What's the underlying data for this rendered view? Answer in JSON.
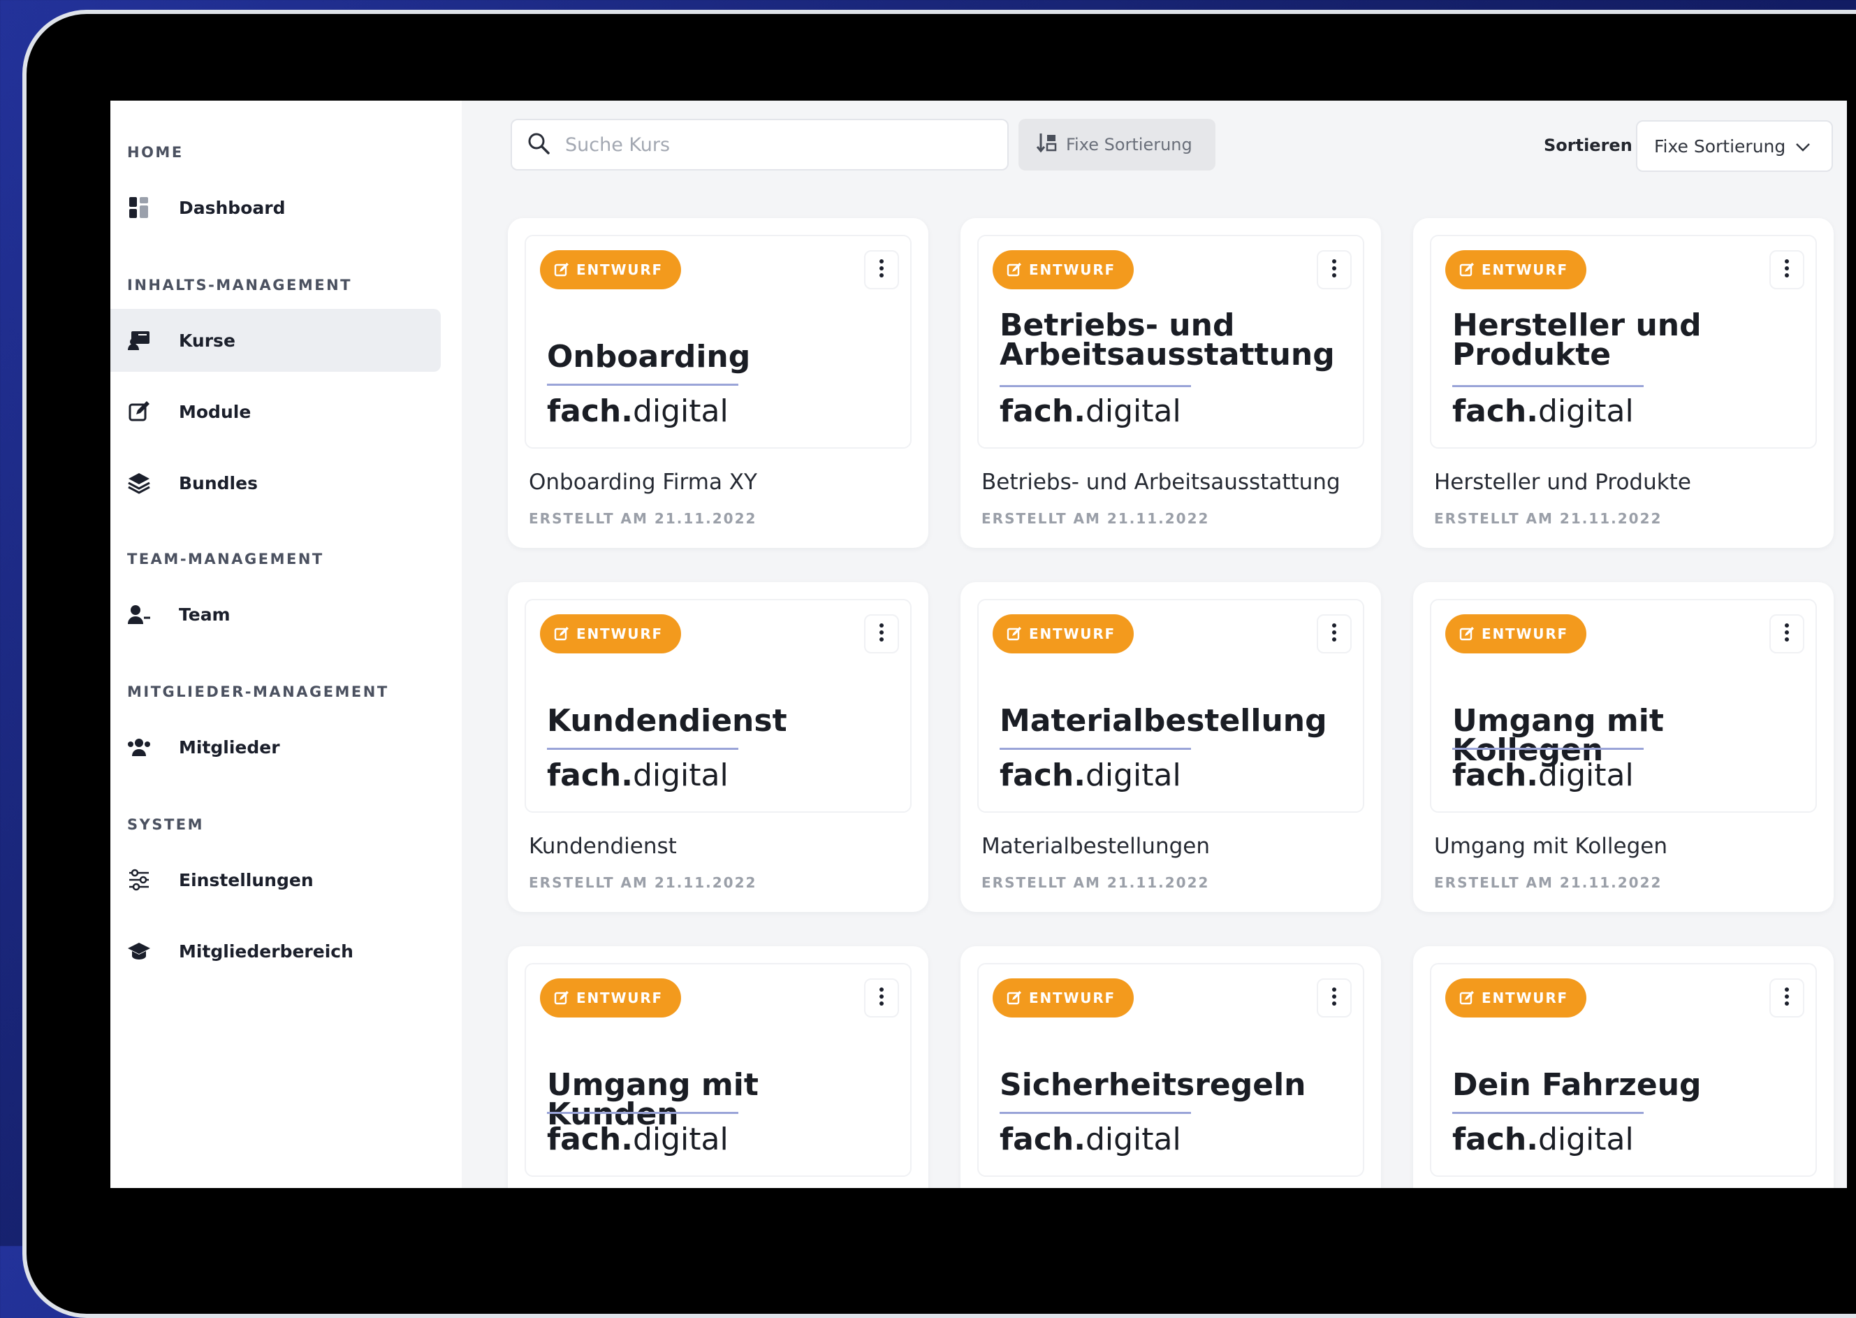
{
  "sidebar": {
    "sections": [
      {
        "label": "HOME"
      },
      {
        "label": "INHALTS-MANAGEMENT"
      },
      {
        "label": "TEAM-MANAGEMENT"
      },
      {
        "label": "MITGLIEDER-MANAGEMENT"
      },
      {
        "label": "SYSTEM"
      }
    ],
    "items": [
      {
        "label": "Dashboard",
        "icon": "dashboard-icon"
      },
      {
        "label": "Kurse",
        "icon": "courses-icon",
        "active": true
      },
      {
        "label": "Module",
        "icon": "edit-icon"
      },
      {
        "label": "Bundles",
        "icon": "layers-icon"
      },
      {
        "label": "Team",
        "icon": "team-icon"
      },
      {
        "label": "Mitglieder",
        "icon": "members-icon"
      },
      {
        "label": "Einstellungen",
        "icon": "sliders-icon"
      },
      {
        "label": "Mitgliederbereich",
        "icon": "graduation-cap-icon"
      }
    ]
  },
  "toolbar": {
    "search_placeholder": "Suche Kurs",
    "sort_chip_label": "Fixe Sortierung",
    "sort_label": "Sortieren",
    "sort_value": "Fixe Sortierung"
  },
  "brand": {
    "bold": "fach.",
    "light": "digital"
  },
  "badge_label": "ENTWURF",
  "colors": {
    "badge": "#f39a1d",
    "active_nav": "#eceef2",
    "title_rule": "#9aa4d8"
  },
  "cards": [
    {
      "title": "Onboarding",
      "name": "Onboarding Firma XY",
      "date": "ERSTELLT AM 21.11.2022"
    },
    {
      "title": "Betriebs- und Arbeitsausstattung",
      "name": "Betriebs- und Arbeitsausstattung",
      "date": "ERSTELLT AM 21.11.2022"
    },
    {
      "title": "Hersteller und Produkte",
      "name": "Hersteller und Produkte",
      "date": "ERSTELLT AM 21.11.2022"
    },
    {
      "title": "Kundendienst",
      "name": "Kundendienst",
      "date": "ERSTELLT AM 21.11.2022"
    },
    {
      "title": "Materialbestellung",
      "name": "Materialbestellungen",
      "date": "ERSTELLT AM 21.11.2022"
    },
    {
      "title": "Umgang mit Kollegen",
      "name": "Umgang mit Kollegen",
      "date": "ERSTELLT AM 21.11.2022"
    },
    {
      "title": "Umgang mit Kunden",
      "name": "",
      "date": ""
    },
    {
      "title": "Sicherheitsregeln",
      "name": "",
      "date": ""
    },
    {
      "title": "Dein Fahrzeug",
      "name": "",
      "date": ""
    }
  ]
}
